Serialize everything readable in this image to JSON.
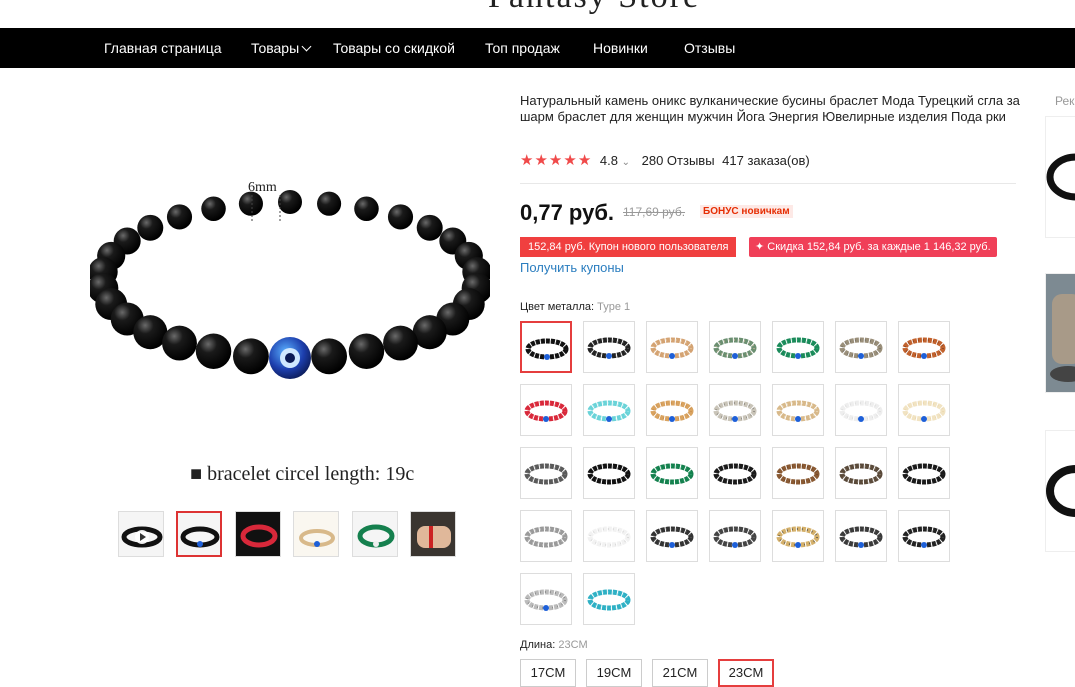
{
  "store": {
    "title": "Fantasy Store"
  },
  "nav": [
    {
      "label": "Главная страница"
    },
    {
      "label": "Товары"
    },
    {
      "label": "Товары со скидкой"
    },
    {
      "label": "Топ продаж"
    },
    {
      "label": "Новинки"
    },
    {
      "label": "Отзывы"
    }
  ],
  "gallery": {
    "size_label": "6mm",
    "caption": "■ bracelet circel length:     19c",
    "thumbnails": [
      "video",
      "black-evil-eye",
      "red",
      "white-evil-eye",
      "green",
      "model-wrist"
    ]
  },
  "product": {
    "title": "Натуральный камень оникс вулканические бусины браслет Мода Турецкий сгла за шарм браслет для женщин мужчин Йога Энергия Ювелирные изделия Пода рки",
    "rating": "4.8",
    "stars": 5,
    "reviews": "280 Отзывы",
    "orders": "417 заказа(ов)",
    "price": "0,77 руб.",
    "old_price": "117,69 руб.",
    "bonus": "БОНУС новичкам",
    "coupon_new_user": "152,84 руб. Купон нового пользователя",
    "coupon_discount": "✦ Скидка 152,84 руб. за каждые 1 146,32 руб.",
    "get_coupons": "Получить купоны"
  },
  "color": {
    "label": "Цвет металла:",
    "value": "Type 1",
    "swatches": [
      {
        "colors": [
          "#111111",
          "#222222"
        ],
        "eye": true
      },
      {
        "colors": [
          "#222222",
          "#555555"
        ],
        "eye": true
      },
      {
        "colors": [
          "#d4a373",
          "#e8c9a0"
        ],
        "eye": true
      },
      {
        "colors": [
          "#6b8f71",
          "#c9b99a"
        ],
        "eye": true
      },
      {
        "colors": [
          "#1b8a5a",
          "#2aa76d"
        ],
        "eye": true
      },
      {
        "colors": [
          "#9a8f7a",
          "#6d6a60"
        ],
        "eye": true
      },
      {
        "colors": [
          "#c2622d",
          "#7a3b1e"
        ],
        "eye": true
      },
      {
        "colors": [
          "#d8283a",
          "#e84a5a"
        ],
        "eye": true
      },
      {
        "colors": [
          "#6ad3d8",
          "#9de6ea"
        ],
        "eye": true
      },
      {
        "colors": [
          "#d9a360",
          "#c58a4a"
        ],
        "eye": true
      },
      {
        "colors": [
          "#c9c4b8",
          "#7d7a72"
        ],
        "eye": true
      },
      {
        "colors": [
          "#d8b98a",
          "#efe2c8"
        ],
        "eye": true
      },
      {
        "colors": [
          "#eeeeee",
          "#d8d8d8"
        ],
        "eye": true
      },
      {
        "colors": [
          "#f1e3c2",
          "#e9d4a8"
        ],
        "eye": true
      },
      {
        "colors": [
          "#5a5a5a",
          "#7a7a7a"
        ],
        "eye": false
      },
      {
        "colors": [
          "#111111",
          "#333333"
        ],
        "eye": false
      },
      {
        "colors": [
          "#15804e",
          "#2aa76d"
        ],
        "eye": false
      },
      {
        "colors": [
          "#1a1a1a",
          "#3a3a3a"
        ],
        "eye": false
      },
      {
        "colors": [
          "#8a5a33",
          "#6a3f22"
        ],
        "eye": false
      },
      {
        "colors": [
          "#5a4a3a",
          "#8a7a6a"
        ],
        "eye": false
      },
      {
        "colors": [
          "#1a1a1a",
          "#2a2a2a"
        ],
        "eye": false
      },
      {
        "colors": [
          "#9a9a9a",
          "#c8c8c8"
        ],
        "eye": false
      },
      {
        "colors": [
          "#f2f2f2",
          "#d0d0d0"
        ],
        "eye": false
      },
      {
        "colors": [
          "#333333",
          "#555555"
        ],
        "eye": true
      },
      {
        "colors": [
          "#444444",
          "#666666"
        ],
        "eye": true
      },
      {
        "colors": [
          "#d4b06a",
          "#444444"
        ],
        "eye": true
      },
      {
        "colors": [
          "#3a3a3a",
          "#5a5a5a"
        ],
        "eye": true
      },
      {
        "colors": [
          "#222222",
          "#444444"
        ],
        "eye": true
      },
      {
        "colors": [
          "#bbbbbb",
          "#777777"
        ],
        "eye": true
      },
      {
        "colors": [
          "#2fb0c4",
          "#4ac6d8"
        ],
        "eye": false
      }
    ]
  },
  "length": {
    "label": "Длина:",
    "value": "23CM",
    "options": [
      "17CM",
      "19CM",
      "21CM",
      "23CM"
    ]
  },
  "recommended": {
    "label": "Рек"
  }
}
